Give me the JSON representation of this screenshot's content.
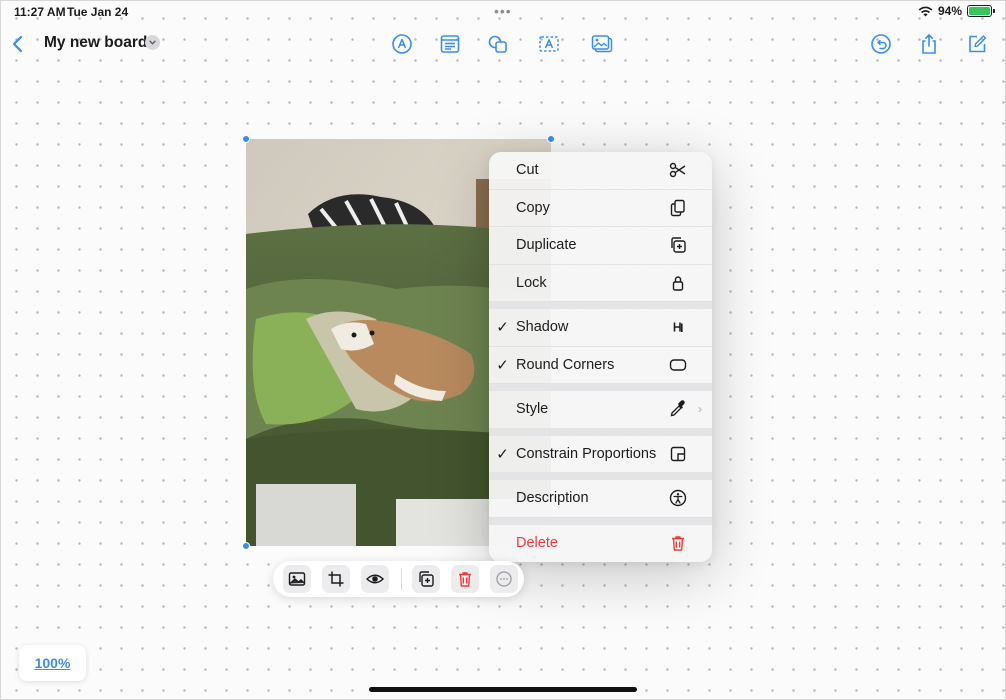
{
  "status_bar": {
    "time": "11:27 AM",
    "date": "Tue Jan 24",
    "battery": "94%"
  },
  "toolbar": {
    "board_title": "My new board",
    "icons": [
      "chevron-left-icon",
      "pen-tip-icon",
      "text-box-icon",
      "shapes-icon",
      "text-frame-icon",
      "media-icon",
      "undo-icon",
      "share-icon",
      "compose-icon"
    ]
  },
  "context_menu": {
    "items": [
      {
        "label": "Cut",
        "checked": false,
        "icon": "scissors-icon"
      },
      {
        "label": "Copy",
        "checked": false,
        "icon": "copy-icon"
      },
      {
        "label": "Duplicate",
        "checked": false,
        "icon": "duplicate-icon"
      },
      {
        "label": "Lock",
        "checked": false,
        "icon": "lock-icon"
      },
      {
        "label": "Shadow",
        "checked": true,
        "icon": "shadow-icon"
      },
      {
        "label": "Round Corners",
        "checked": true,
        "icon": "rounded-rect-icon"
      },
      {
        "label": "Style",
        "checked": false,
        "icon": "eyedropper-icon"
      },
      {
        "label": "Constrain Proportions",
        "checked": true,
        "icon": "constrain-icon"
      },
      {
        "label": "Description",
        "checked": false,
        "icon": "accessibility-icon"
      },
      {
        "label": "Delete",
        "checked": false,
        "icon": "trash-icon",
        "destructive": true
      }
    ],
    "check_glyph": "✓"
  },
  "image_toolbar": {
    "icons": [
      "replace-image-icon",
      "crop-icon",
      "preview-eye-icon",
      "duplicate-icon",
      "trash-icon",
      "more-icon"
    ]
  },
  "zoom": {
    "level": "100%"
  },
  "colors": {
    "accent": "#3a8ee8",
    "destructive": "#ef3b32"
  }
}
